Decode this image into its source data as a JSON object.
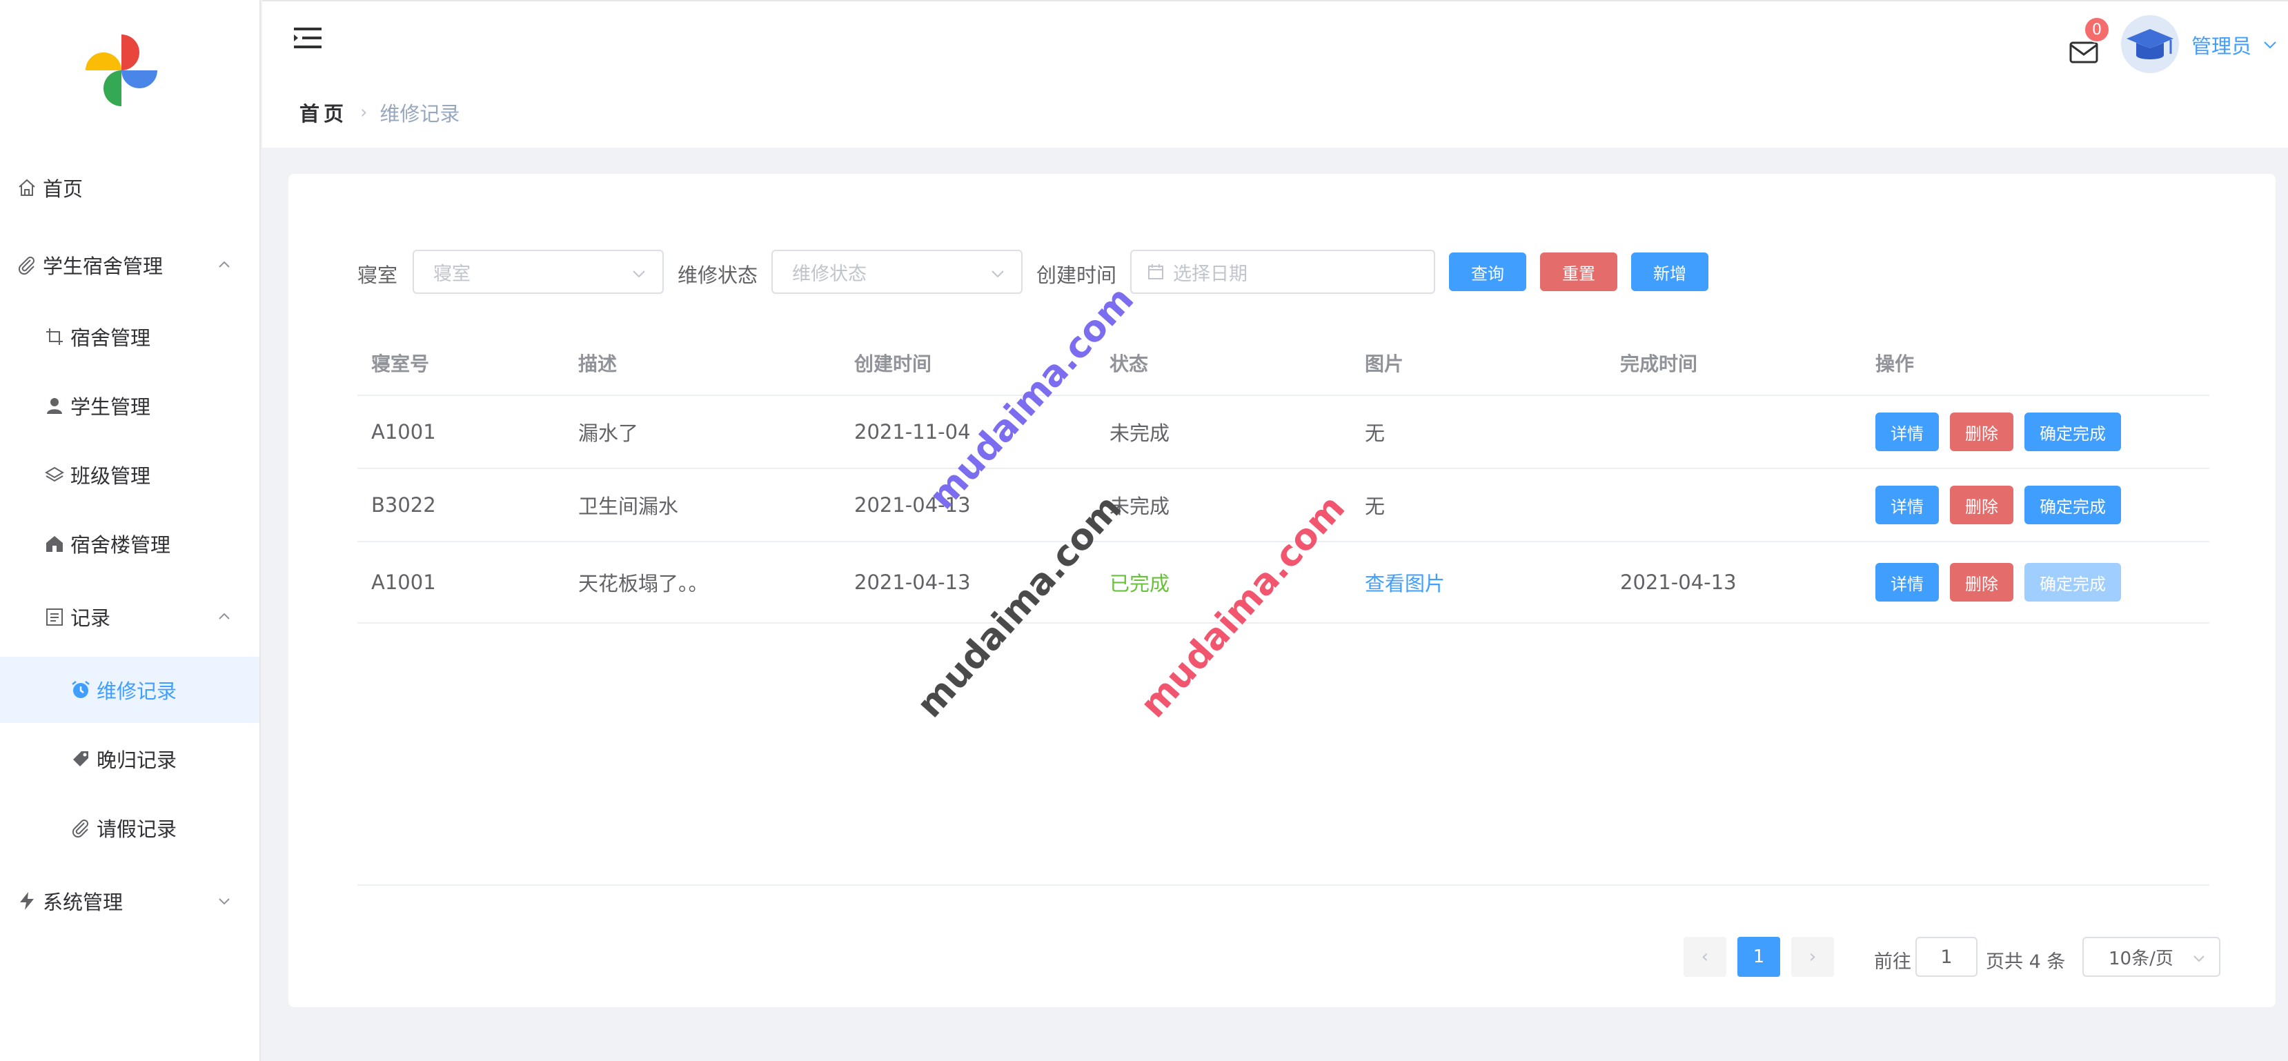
{
  "sidebar": {
    "items": [
      {
        "label": "首页",
        "icon": "home-icon"
      },
      {
        "label": "学生宿舍管理",
        "icon": "paperclip-icon",
        "expanded": true
      },
      {
        "label": "宿舍管理",
        "icon": "crop-icon"
      },
      {
        "label": "学生管理",
        "icon": "user-icon"
      },
      {
        "label": "班级管理",
        "icon": "layers-icon"
      },
      {
        "label": "宿舍楼管理",
        "icon": "house-icon"
      },
      {
        "label": "记录",
        "icon": "list-icon",
        "expanded": true
      },
      {
        "label": "维修记录",
        "icon": "clock-icon",
        "active": true
      },
      {
        "label": "晚归记录",
        "icon": "tag-icon"
      },
      {
        "label": "请假记录",
        "icon": "paperclip-icon"
      },
      {
        "label": "系统管理",
        "icon": "lightning-icon",
        "expanded": false
      }
    ]
  },
  "header": {
    "breadcrumb": {
      "home": "首页",
      "current": "维修记录"
    },
    "notification_count": "0",
    "user_name": "管理员"
  },
  "filters": {
    "room_label": "寝室",
    "room_placeholder": "寝室",
    "status_label": "维修状态",
    "status_placeholder": "维修状态",
    "created_label": "创建时间",
    "date_placeholder": "选择日期",
    "query_button": "查询",
    "reset_button": "重置",
    "add_button": "新增"
  },
  "table": {
    "columns": [
      "寝室号",
      "描述",
      "创建时间",
      "状态",
      "图片",
      "完成时间",
      "操作"
    ],
    "rows": [
      {
        "room": "A1001",
        "desc": "漏水了",
        "created": "2021-11-04",
        "status": "未完成",
        "image": "无",
        "finished": ""
      },
      {
        "room": "B3022",
        "desc": "卫生间漏水",
        "created": "2021-04-13",
        "status": "未完成",
        "image": "无",
        "finished": ""
      },
      {
        "room": "A1001",
        "desc": "天花板塌了。。",
        "created": "2021-04-13",
        "status": "已完成",
        "image": "查看图片",
        "finished": "2021-04-13"
      }
    ],
    "actions": {
      "detail": "详情",
      "delete": "删除",
      "confirm": "确定完成"
    }
  },
  "pagination": {
    "current_page": "1",
    "goto_label": "前往",
    "goto_value": "1",
    "total_label": "页共 4 条",
    "page_size": "10条/页"
  },
  "watermarks": [
    "mudaima.com",
    "mudaima.com",
    "mudaima.com"
  ],
  "colors": {
    "primary": "#409eff",
    "danger": "#e46c6a",
    "success": "#67c23a",
    "disabled": "#a0cfff"
  }
}
